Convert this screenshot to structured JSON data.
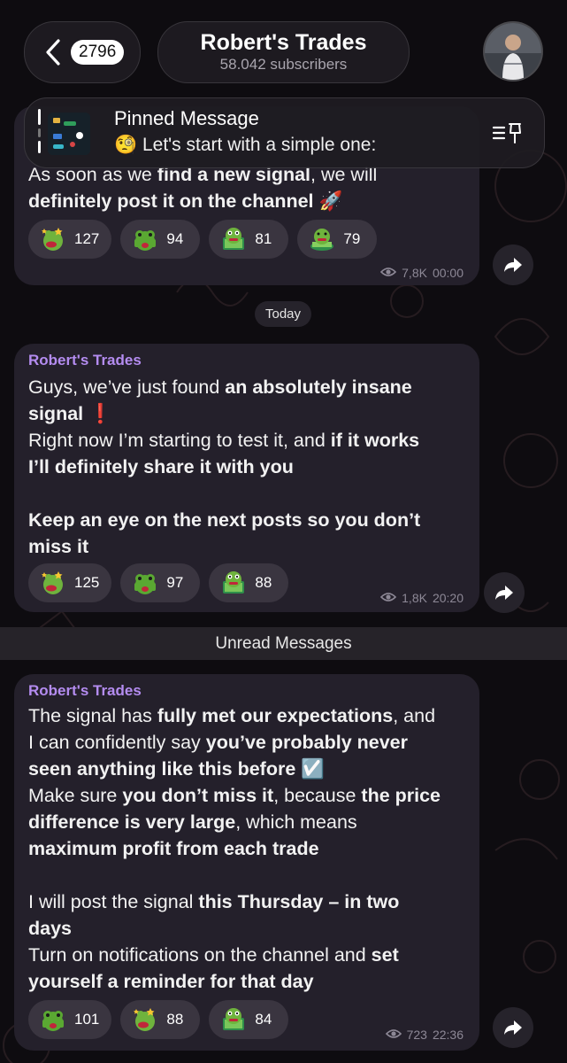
{
  "header": {
    "back_count": "2796",
    "channel_name": "Robert's Trades",
    "subscribers": "58.042 subscribers"
  },
  "pinned": {
    "title": "Pinned Message",
    "preview": "🧐 Let's start with a simple one:"
  },
  "messages": [
    {
      "id": "msg1",
      "lines": [
        [
          {
            "t": "As soon as we "
          },
          {
            "t": "find a new signal",
            "b": true
          },
          {
            "t": ", we will"
          }
        ],
        [
          {
            "t": "definitely post it on the channel",
            "b": true
          },
          {
            "t": " 🚀"
          }
        ]
      ],
      "reactions": [
        {
          "emoji": "kiss-frog-icon",
          "count": "127"
        },
        {
          "emoji": "shocked-frog-icon",
          "count": "94"
        },
        {
          "emoji": "money-frog-icon",
          "count": "81"
        },
        {
          "emoji": "cash-frog-icon",
          "count": "79"
        }
      ],
      "views": "7,8K",
      "time": "00:00"
    },
    {
      "id": "msg2",
      "sender": "Robert's Trades",
      "lines": [
        [
          {
            "t": "Guys, we’ve just found "
          },
          {
            "t": "an absolutely insane",
            "b": true
          }
        ],
        [
          {
            "t": "signal",
            "b": true
          },
          {
            "t": " ❗"
          }
        ],
        [
          {
            "t": "Right now I’m starting to test it, and "
          },
          {
            "t": "if it works",
            "b": true
          }
        ],
        [
          {
            "t": "I’ll definitely share it with you",
            "b": true
          }
        ],
        [
          {
            "t": ""
          }
        ],
        [
          {
            "t": "Keep an eye on the next posts so you don’t",
            "b": true
          }
        ],
        [
          {
            "t": "miss it",
            "b": true
          }
        ]
      ],
      "reactions": [
        {
          "emoji": "kiss-frog-icon",
          "count": "125"
        },
        {
          "emoji": "shocked-frog-icon",
          "count": "97"
        },
        {
          "emoji": "money-frog-icon",
          "count": "88"
        }
      ],
      "views": "1,8K",
      "time": "20:20"
    },
    {
      "id": "msg3",
      "sender": "Robert's Trades",
      "lines": [
        [
          {
            "t": "The signal has "
          },
          {
            "t": "fully met our expectations",
            "b": true
          },
          {
            "t": ", and"
          }
        ],
        [
          {
            "t": "I can confidently say "
          },
          {
            "t": "you’ve probably never",
            "b": true
          }
        ],
        [
          {
            "t": "seen anything like this before",
            "b": true
          },
          {
            "t": " ☑️"
          }
        ],
        [
          {
            "t": "Make sure "
          },
          {
            "t": "you don’t miss it",
            "b": true
          },
          {
            "t": ", because "
          },
          {
            "t": "the price",
            "b": true
          }
        ],
        [
          {
            "t": "difference is very large",
            "b": true
          },
          {
            "t": ", which means"
          }
        ],
        [
          {
            "t": "maximum profit from each trade",
            "b": true
          }
        ],
        [
          {
            "t": ""
          }
        ],
        [
          {
            "t": "I will post the signal "
          },
          {
            "t": "this Thursday – in two",
            "b": true
          }
        ],
        [
          {
            "t": "days",
            "b": true
          }
        ],
        [
          {
            "t": "Turn on notifications on the channel and "
          },
          {
            "t": "set",
            "b": true
          }
        ],
        [
          {
            "t": "yourself a reminder for that day",
            "b": true
          }
        ]
      ],
      "reactions": [
        {
          "emoji": "shocked-frog-icon",
          "count": "101"
        },
        {
          "emoji": "kiss-frog-icon",
          "count": "88"
        },
        {
          "emoji": "money-frog-icon",
          "count": "84"
        }
      ],
      "views": "723",
      "time": "22:36"
    }
  ],
  "date_chip": "Today",
  "unread_label": "Unread Messages",
  "colors": {
    "background": "#0e0c10",
    "bubble": "#24202b",
    "sender": "#b48cf0",
    "reaction_bg": "#3a3540",
    "meta": "#8d8896"
  }
}
